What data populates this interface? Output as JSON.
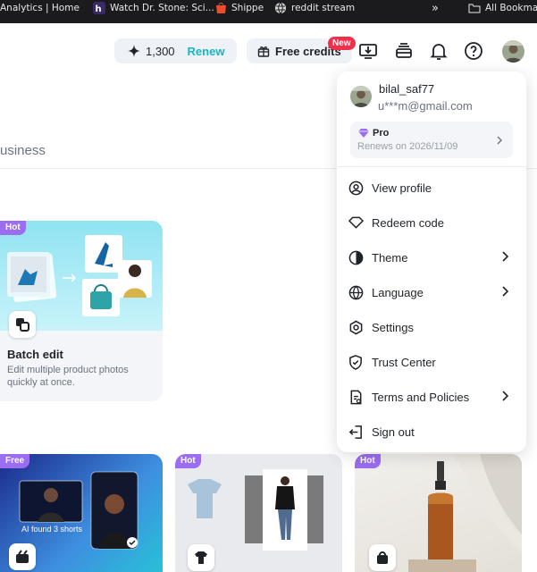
{
  "bookmarks": [
    {
      "label": "Analytics | Home",
      "icon": "bookmark-icon"
    },
    {
      "label": "Watch Dr. Stone: Sci...",
      "icon": "h-site-icon"
    },
    {
      "label": "Shippe",
      "icon": "shopee-icon"
    },
    {
      "label": "reddit stream",
      "icon": "globe-icon"
    }
  ],
  "bookmarks_overflow": "»",
  "all_bookmarks": "All Bookmarks",
  "header": {
    "credits_value": "1,300",
    "renew_label": "Renew",
    "free_credits_label": "Free credits",
    "new_badge": "New"
  },
  "page": {
    "section_heading_fragment": "usiness"
  },
  "cards": {
    "batch": {
      "badge": "Hot",
      "title": "Batch edit",
      "desc": "Edit multiple product photos quickly at once."
    },
    "shorts": {
      "badge": "Free",
      "caption": "AI found 3 shorts"
    },
    "tryon": {
      "badge": "Hot"
    },
    "product": {
      "badge": "Hot"
    }
  },
  "menu": {
    "username": "bilal_saf77",
    "email": "u***m@gmail.com",
    "plan": "Pro",
    "renews": "Renews on 2026/11/09",
    "items": [
      {
        "label": "View profile",
        "icon": "user-circle-icon"
      },
      {
        "label": "Redeem code",
        "icon": "diamond-icon"
      },
      {
        "label": "Theme",
        "icon": "contrast-icon"
      },
      {
        "label": "Language",
        "icon": "globe-icon"
      },
      {
        "label": "Settings",
        "icon": "gear-icon"
      },
      {
        "label": "Trust Center",
        "icon": "shield-icon"
      },
      {
        "label": "Terms and Policies",
        "icon": "document-icon"
      },
      {
        "label": "Sign out",
        "icon": "sign-out-icon"
      }
    ]
  },
  "colors": {
    "accent_teal": "#14b8c6",
    "badge_purple": "#9b6df0",
    "new_badge_red": "#f0304a",
    "pill_bg": "#eef1f6"
  }
}
